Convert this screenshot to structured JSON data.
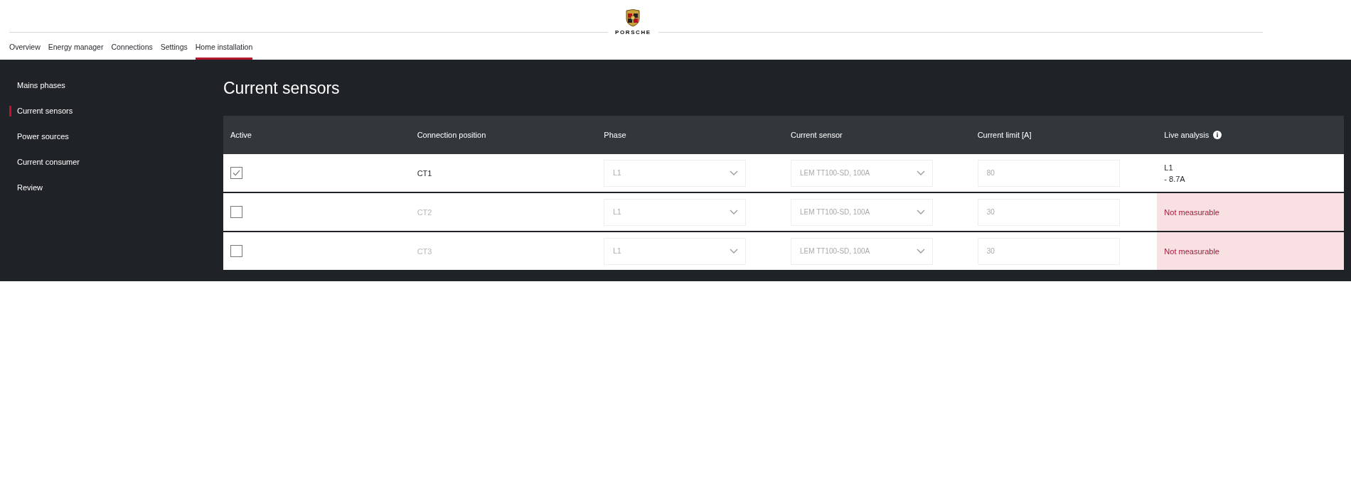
{
  "brand": {
    "name": "PORSCHE"
  },
  "nav": [
    {
      "label": "Overview",
      "selected": false
    },
    {
      "label": "Energy manager",
      "selected": false
    },
    {
      "label": "Connections",
      "selected": false
    },
    {
      "label": "Settings",
      "selected": false
    },
    {
      "label": "Home installation",
      "selected": true
    }
  ],
  "sidebar": {
    "items": [
      {
        "label": "Mains phases",
        "selected": false
      },
      {
        "label": "Current sensors",
        "selected": true
      },
      {
        "label": "Power sources",
        "selected": false
      },
      {
        "label": "Current consumer",
        "selected": false
      },
      {
        "label": "Review",
        "selected": false
      }
    ]
  },
  "page_title": "Current sensors",
  "table": {
    "columns": [
      "Active",
      "Connection position",
      "Phase",
      "Current sensor",
      "Current limit [A]",
      "Live analysis"
    ],
    "rows": [
      {
        "active": true,
        "position": "CT1",
        "phase": "L1",
        "sensor": "LEM TT100-SD, 100A",
        "limit": "80",
        "live": {
          "kind": "reading",
          "lines": [
            "L1",
            "- 8.7A"
          ]
        }
      },
      {
        "active": false,
        "position": "CT2",
        "phase": "L1",
        "sensor": "LEM TT100-SD, 100A",
        "limit": "30",
        "live": {
          "kind": "error",
          "lines": [
            "Not measurable"
          ]
        }
      },
      {
        "active": false,
        "position": "CT3",
        "phase": "L1",
        "sensor": "LEM TT100-SD, 100A",
        "limit": "30",
        "live": {
          "kind": "error",
          "lines": [
            "Not measurable"
          ]
        }
      }
    ]
  }
}
